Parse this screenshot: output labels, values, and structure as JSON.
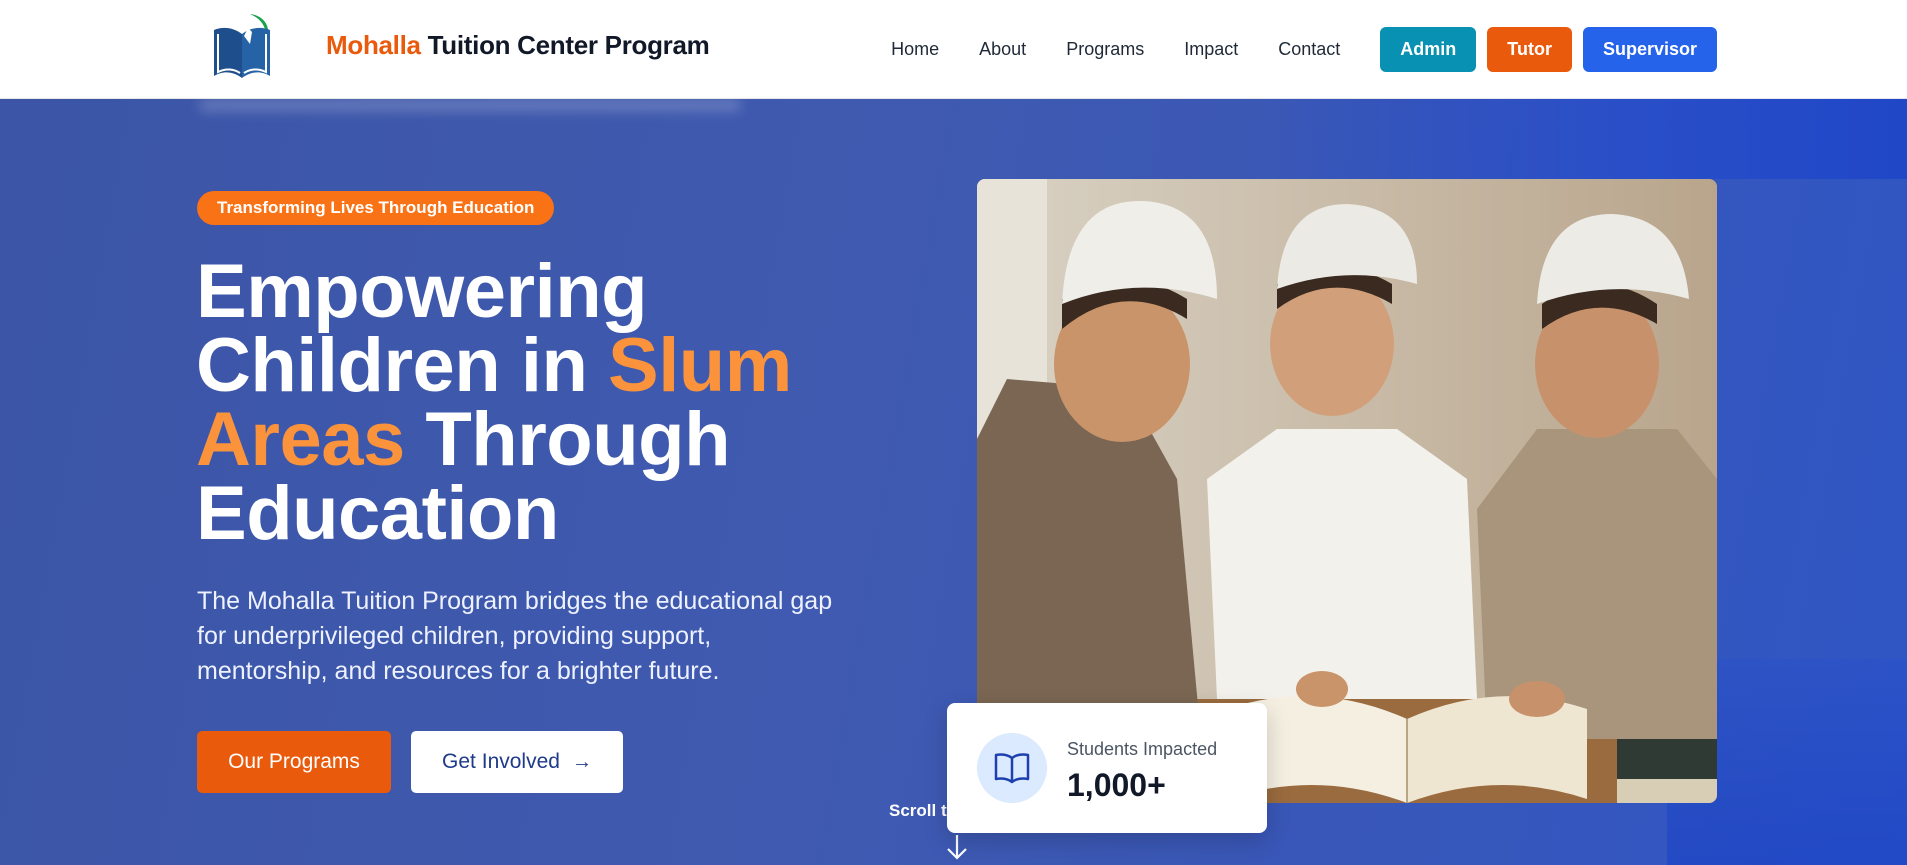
{
  "header": {
    "brand_accent": "Mohalla",
    "brand_rest": "Tuition Center Program",
    "nav": [
      "Home",
      "About",
      "Programs",
      "Impact",
      "Contact"
    ],
    "buttons": {
      "admin": "Admin",
      "tutor": "Tutor",
      "supervisor": "Supervisor"
    }
  },
  "hero": {
    "tag": "Transforming Lives Through Education",
    "title": {
      "line1": "Empowering",
      "line2_a": "Children in ",
      "line2_b": "Slum",
      "line3_a": "Areas",
      "line3_b": " Through",
      "line4": "Education"
    },
    "description": "The Mohalla Tuition Program bridges the educational gap for underprivileged children, providing support, mentorship, and resources for a brighter future.",
    "primary_button": "Our Programs",
    "secondary_button": "Get Involved",
    "scroll_label": "Scroll t"
  },
  "stat": {
    "label": "Students Impacted",
    "value": "1,000+",
    "icon": "open-book-icon"
  },
  "colors": {
    "accent_orange": "#ea5a0c",
    "highlight_orange": "#fb923c",
    "admin_teal": "#0891b2",
    "supervisor_blue": "#2563eb",
    "hero_blue": "#3f5ab0"
  }
}
